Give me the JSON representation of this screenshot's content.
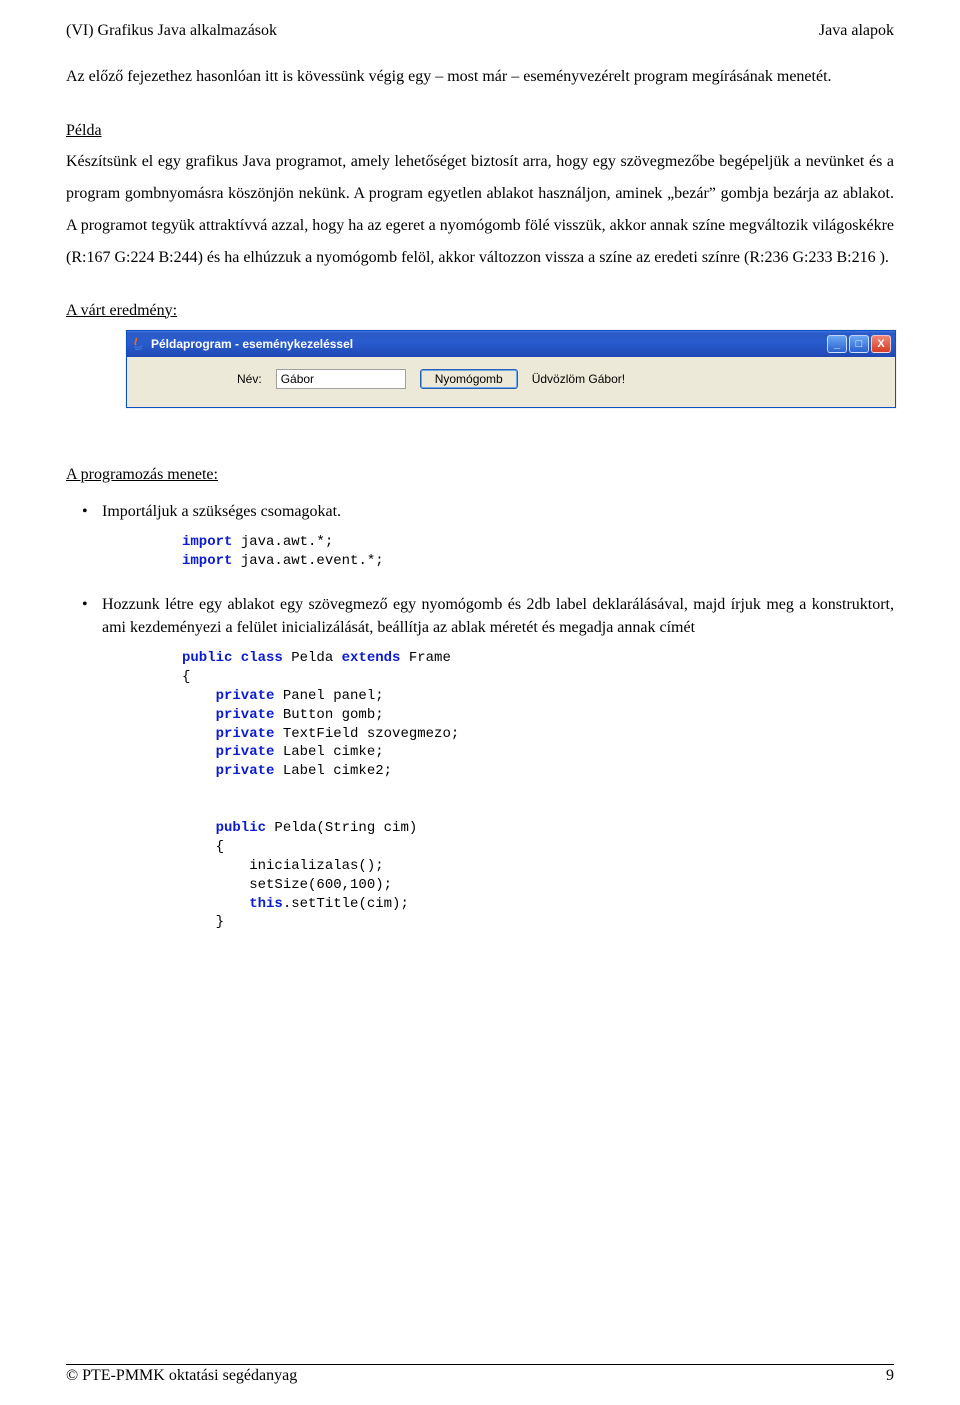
{
  "header": {
    "left": "(VI) Grafikus Java alkalmazások",
    "right": "Java alapok"
  },
  "intro": "Az előző fejezethez hasonlóan itt is kövessünk végig egy – most már – eseményvezérelt program megírásának menetét.",
  "section_pelda_title": "Példa",
  "body_main": "Készítsünk el egy grafikus Java programot, amely lehetőséget biztosít arra, hogy egy szövegmezőbe begépeljük a nevünket és a program gombnyomásra köszönjön nekünk. A program egyetlen ablakot használjon, aminek „bezár” gombja bezárja az ablakot. A programot tegyük attraktívvá azzal, hogy ha az egeret a nyomógomb fölé visszük, akkor annak színe megváltozik világoskékre (R:167 G:224 B:244) és ha elhúzzuk a nyomógomb felöl, akkor változzon vissza a színe az eredeti színre (R:236 G:233 B:216 ).",
  "expected_title": "A várt eredmény:",
  "window": {
    "title": "Példaprogram - eseménykezeléssel",
    "name_label": "Név:",
    "input_value": "Gábor",
    "button_label": "Nyomógomb",
    "greeting": "Üdvözlöm Gábor!",
    "min_tip": "_",
    "max_tip": "□",
    "close_tip": "X"
  },
  "steps_title": "A programozás menete:",
  "step1": "Importáljuk a szükséges csomagokat.",
  "code1_l1": "import",
  "code1_l1_rest": " java.awt.*;",
  "code1_l2": "import",
  "code1_l2_rest": " java.awt.event.*;",
  "step2": "Hozzunk létre egy ablakot egy szövegmező egy nyomógomb és 2db label deklarálásával, majd írjuk meg a konstruktort, ami kezdeményezi a felület inicializálását, beállítja az ablak méretét és megadja annak címét",
  "code2": {
    "l1a": "public class",
    "l1b": " Pelda ",
    "l1c": "extends",
    "l1d": " Frame",
    "l2": "{",
    "l3a": "    private",
    "l3b": " Panel panel;",
    "l4a": "    private",
    "l4b": " Button gomb;",
    "l5a": "    private",
    "l5b": " TextField szovegmezo;",
    "l6a": "    private",
    "l6b": " Label cimke;",
    "l7a": "    private",
    "l7b": " Label cimke2;",
    "blank": "",
    "l9a": "    public",
    "l9b": " Pelda(String cim)",
    "l10": "    {",
    "l11": "        inicializalas();",
    "l12": "        setSize(600,100);",
    "l13a": "        this",
    "l13b": ".setTitle(cim);",
    "l14": "    }"
  },
  "footer": {
    "left": "© PTE-PMMK oktatási segédanyag",
    "right": "9"
  }
}
